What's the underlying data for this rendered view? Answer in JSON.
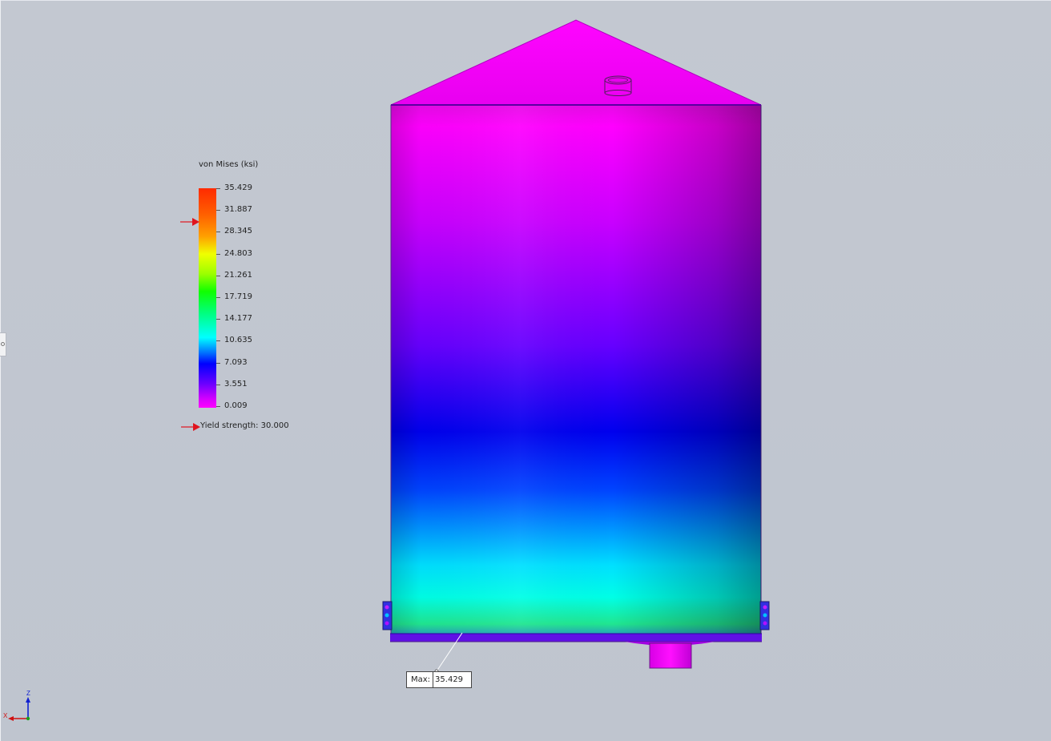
{
  "legend": {
    "title": "von Mises (ksi)",
    "ticks": [
      "35.429",
      "31.887",
      "28.345",
      "24.803",
      "21.261",
      "17.719",
      "14.177",
      "10.635",
      "7.093",
      "3.551",
      "0.009"
    ],
    "min": 0.009,
    "max": 35.429,
    "yield_marker_value": 30.0,
    "yield_label": "Yield strength: 30.000"
  },
  "probe": {
    "label": "Max:",
    "value": "35.429"
  },
  "triad": {
    "z_label": "Z",
    "x_label": "X"
  },
  "colors": {
    "background": "#c1c6d0",
    "yield_arrow": "#e0141e",
    "triad_x": "#d01010",
    "triad_y": "#1aa01a",
    "triad_z": "#1020d0"
  }
}
